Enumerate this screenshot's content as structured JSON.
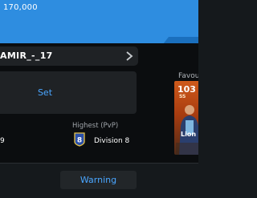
{
  "header": {
    "coins": "170,000"
  },
  "profile": {
    "username": "AMIR_-_17",
    "set_label": "Set",
    "left_value": "9"
  },
  "rank": {
    "highest_label": "Highest (PvP)",
    "division_number": "8",
    "division_label": "Division 8"
  },
  "favourite": {
    "label": "Favour",
    "card_rating": "103",
    "card_position": "SS",
    "card_name": "Lion"
  },
  "footer": {
    "warning_label": "Warning"
  },
  "colors": {
    "accent_blue": "#2e8de0",
    "link_blue": "#4aa6ff",
    "card_orange": "#cf5a1b"
  }
}
